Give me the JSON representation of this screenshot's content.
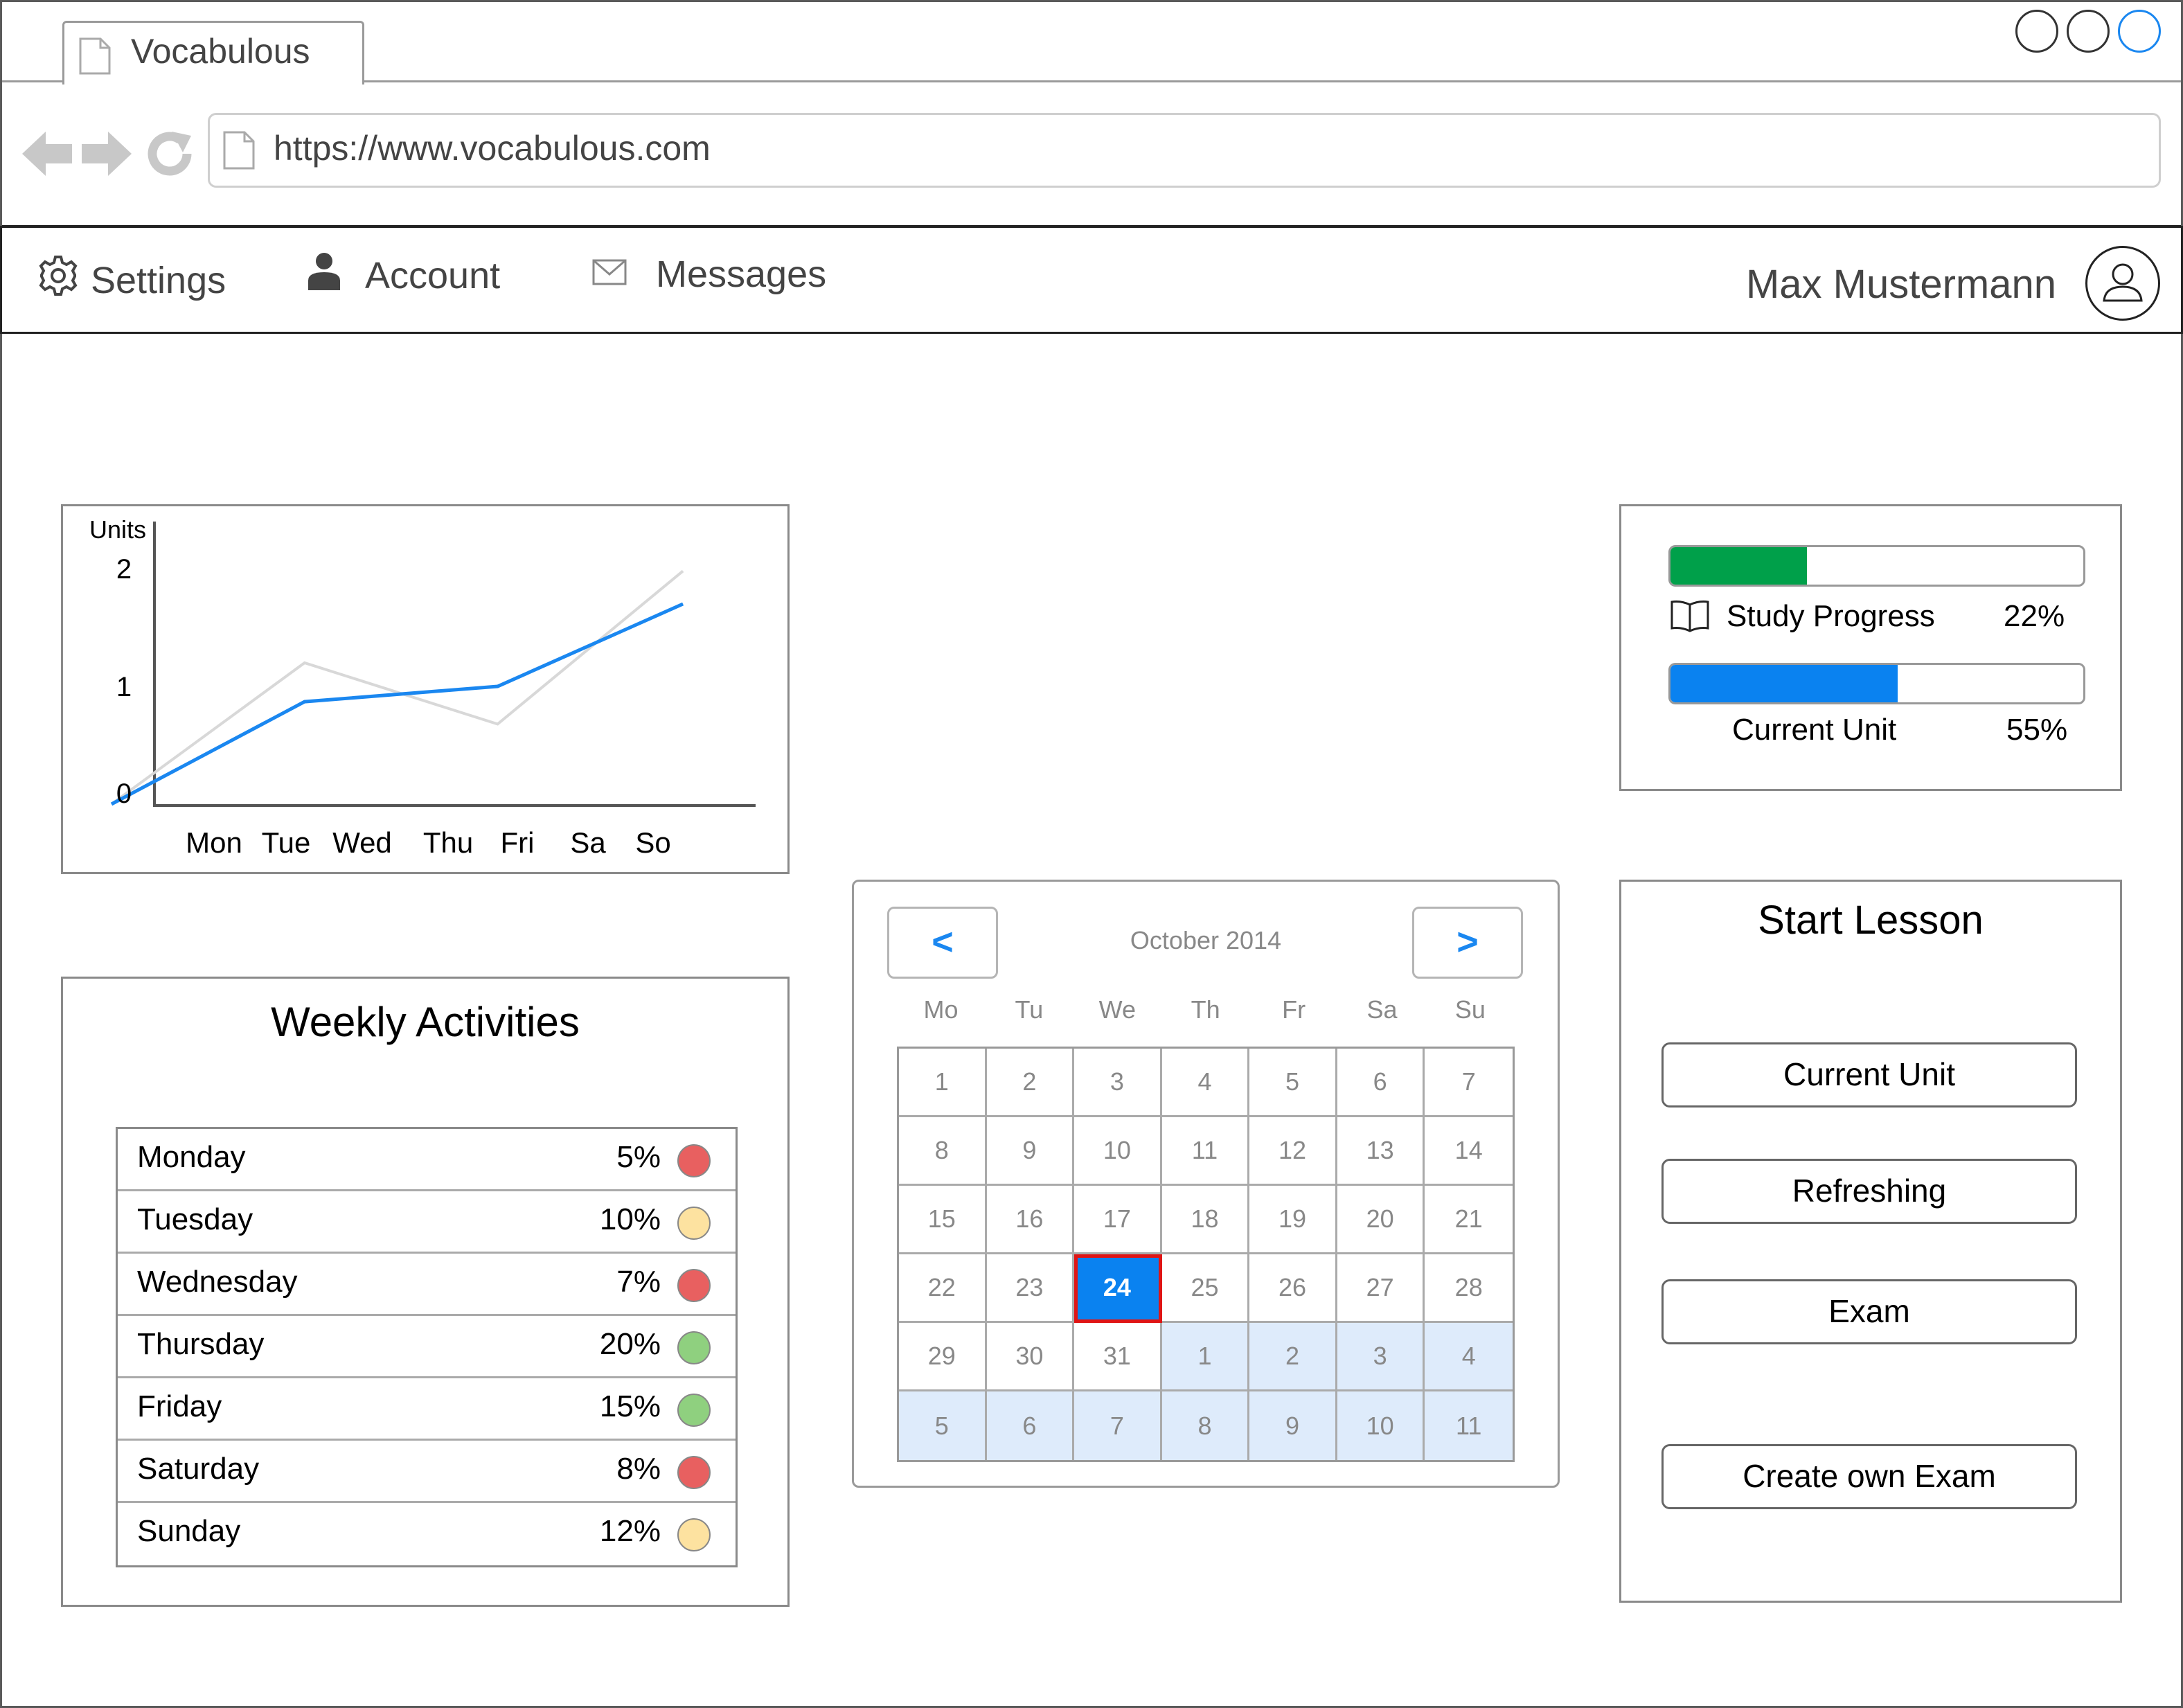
{
  "browser": {
    "tab_title": "Vocabulous",
    "url": "https://www.vocabulous.com",
    "window_controls": [
      "minimize",
      "maximize",
      "close"
    ],
    "accent": "#1a87f0"
  },
  "menu": {
    "settings": {
      "label": "Settings",
      "icon": "gear-icon"
    },
    "account": {
      "label": "Account",
      "icon": "person-icon"
    },
    "messages": {
      "label": "Messages",
      "icon": "envelope-icon"
    },
    "user_name": "Max Mustermann",
    "avatar_icon": "user-avatar-icon"
  },
  "chart_data": {
    "type": "line",
    "title": "",
    "xlabel": "",
    "ylabel": "Units",
    "categories": [
      "Mon",
      "Tue",
      "Wed",
      "Thu",
      "Fri",
      "Sa",
      "So"
    ],
    "ylim": [
      0,
      2.2
    ],
    "yticks": [
      "0",
      "1",
      "2"
    ],
    "series": [
      {
        "color": "#1a87f0",
        "x": [
          0,
          2.5,
          5,
          7.4
        ],
        "y": [
          0,
          0.87,
          1,
          1.7
        ]
      },
      {
        "color": "#d8d8d8",
        "x": [
          0,
          2.5,
          5,
          7.4
        ],
        "y": [
          0,
          1.2,
          0.68,
          1.98
        ]
      }
    ]
  },
  "progress": {
    "study": {
      "label": "Study Progress",
      "pct": "22%",
      "fill": 0.33,
      "color": "#00a04a",
      "icon": "book-icon"
    },
    "unit": {
      "label": "Current Unit",
      "pct": "55%",
      "fill": 0.55,
      "color": "#0a82f0"
    }
  },
  "weekly": {
    "title": "Weekly Activities",
    "rows": [
      {
        "day": "Monday",
        "pct": "5%",
        "status": "red",
        "color": "#e86060"
      },
      {
        "day": "Tuesday",
        "pct": "10%",
        "status": "yellow",
        "color": "#fde2a0"
      },
      {
        "day": "Wednesday",
        "pct": "7%",
        "status": "red",
        "color": "#e86060"
      },
      {
        "day": "Thursday",
        "pct": "20%",
        "status": "green",
        "color": "#8fd07f"
      },
      {
        "day": "Friday",
        "pct": "15%",
        "status": "green",
        "color": "#8fd07f"
      },
      {
        "day": "Saturday",
        "pct": "8%",
        "status": "red",
        "color": "#e86060"
      },
      {
        "day": "Sunday",
        "pct": "12%",
        "status": "yellow",
        "color": "#fde2a0"
      }
    ]
  },
  "calendar": {
    "title": "October 2014",
    "prev": "<",
    "next": ">",
    "weekdays": [
      "Mo",
      "Tu",
      "We",
      "Th",
      "Fr",
      "Sa",
      "Su"
    ],
    "days": [
      "1",
      "2",
      "3",
      "4",
      "5",
      "6",
      "7",
      "8",
      "9",
      "10",
      "11",
      "12",
      "13",
      "14",
      "15",
      "16",
      "17",
      "18",
      "19",
      "20",
      "21",
      "22",
      "23",
      "24",
      "25",
      "26",
      "27",
      "28",
      "29",
      "30",
      "31",
      "1",
      "2",
      "3",
      "4",
      "5",
      "6",
      "7",
      "8",
      "9",
      "10",
      "11"
    ],
    "selected": "24",
    "other_month_start": 31
  },
  "lesson": {
    "title": "Start Lesson",
    "buttons": [
      "Current Unit",
      "Refreshing",
      "Exam",
      "Create own Exam"
    ]
  }
}
